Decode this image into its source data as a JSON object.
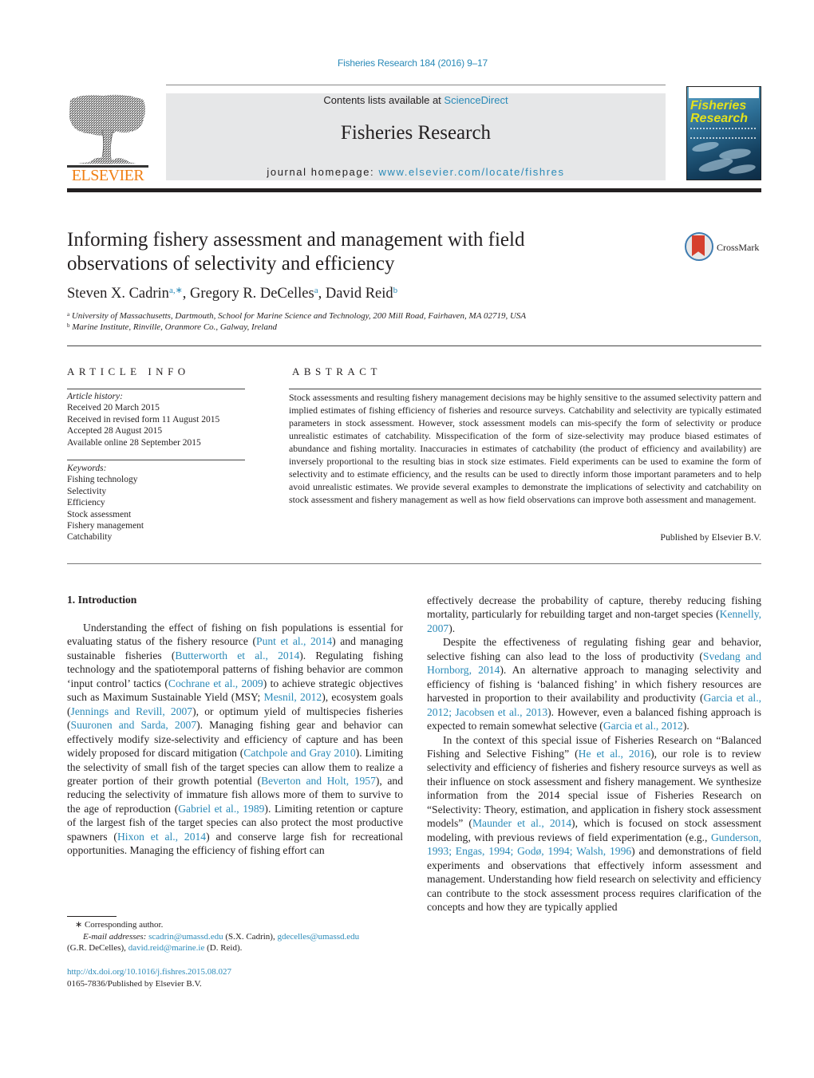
{
  "header": {
    "citation": "Fisheries Research 184 (2016) 9–17",
    "contents_prefix": "Contents lists available at ",
    "contents_link": "ScienceDirect",
    "journal_title": "Fisheries Research",
    "homepage_prefix": "journal homepage: ",
    "homepage_link": "www.elsevier.com/locate/fishres",
    "publisher_logo": "ELSEVIER",
    "cover_title_line1": "Fisheries",
    "cover_title_line2": "Research",
    "crossmark_label": "CrossMark"
  },
  "article": {
    "title": "Informing fishery assessment and management with field observations of selectivity and efficiency",
    "authors": [
      {
        "name": "Steven X. Cadrin",
        "marks": "a,∗"
      },
      {
        "name": "Gregory R. DeCelles",
        "marks": "a"
      },
      {
        "name": "David Reid",
        "marks": "b"
      }
    ],
    "affiliations": [
      {
        "mark": "a",
        "text": "University of Massachusetts, Dartmouth, School for Marine Science and Technology, 200 Mill Road, Fairhaven, MA 02719, USA"
      },
      {
        "mark": "b",
        "text": "Marine Institute, Rinville, Oranmore Co., Galway, Ireland"
      }
    ]
  },
  "article_info": {
    "heading": "ARTICLE INFO",
    "history_label": "Article history:",
    "history": [
      "Received 20 March 2015",
      "Received in revised form 11 August 2015",
      "Accepted 28 August 2015",
      "Available online 28 September 2015"
    ],
    "keywords_label": "Keywords:",
    "keywords": [
      "Fishing technology",
      "Selectivity",
      "Efficiency",
      "Stock assessment",
      "Fishery management",
      "Catchability"
    ]
  },
  "abstract": {
    "heading": "ABSTRACT",
    "text": "Stock assessments and resulting fishery management decisions may be highly sensitive to the assumed selectivity pattern and implied estimates of fishing efficiency of fisheries and resource surveys. Catchability and selectivity are typically estimated parameters in stock assessment. However, stock assessment models can mis-specify the form of selectivity or produce unrealistic estimates of catchability. Misspecification of the form of size-selectivity may produce biased estimates of abundance and fishing mortality. Inaccuracies in estimates of catchability (the product of efficiency and availability) are inversely proportional to the resulting bias in stock size estimates. Field experiments can be used to examine the form of selectivity and to estimate efficiency, and the results can be used to directly inform those important parameters and to help avoid unrealistic estimates. We provide several examples to demonstrate the implications of selectivity and catchability on stock assessment and fishery management as well as how field observations can improve both assessment and management.",
    "publisher": "Published by Elsevier B.V."
  },
  "introduction": {
    "heading": "1.  Introduction",
    "left_paragraph": [
      {
        "t": "Understanding the effect of fishing on fish populations is essential for evaluating status of the fishery resource ("
      },
      {
        "l": "Punt et al., 2014"
      },
      {
        "t": ") and managing sustainable fisheries ("
      },
      {
        "l": "Butterworth et al., 2014"
      },
      {
        "t": "). Regulating fishing technology and the spatiotemporal patterns of fishing behavior are common ‘input control’ tactics ("
      },
      {
        "l": "Cochrane et al., 2009"
      },
      {
        "t": ") to achieve strategic objectives such as Maximum Sustainable Yield (MSY; "
      },
      {
        "l": "Mesnil, 2012"
      },
      {
        "t": "), ecosystem goals ("
      },
      {
        "l": "Jennings and Revill, 2007"
      },
      {
        "t": "), or optimum yield of multispecies fisheries ("
      },
      {
        "l": "Suuronen and Sarda, 2007"
      },
      {
        "t": "). Managing fishing gear and behavior can effectively modify size-selectivity and efficiency of capture and has been widely proposed for discard mitigation ("
      },
      {
        "l": "Catchpole and Gray 2010"
      },
      {
        "t": "). Limiting the selectivity of small fish of the target species can allow them to realize a greater portion of their growth potential ("
      },
      {
        "l": "Beverton and Holt, 1957"
      },
      {
        "t": "), and reducing the selectivity of immature fish allows more of them to survive to the age of reproduction ("
      },
      {
        "l": "Gabriel et al., 1989"
      },
      {
        "t": "). Limiting retention or capture of the largest fish of the target species can also protect the most productive spawners ("
      },
      {
        "l": "Hixon et al., 2014"
      },
      {
        "t": ") and conserve large fish for recreational opportunities. Managing the efficiency of fishing effort can"
      }
    ],
    "right_paragraphs": [
      {
        "indent": false,
        "parts": [
          {
            "t": "effectively decrease the probability of capture, thereby reducing fishing mortality, particularly for rebuilding target and non-target species ("
          },
          {
            "l": "Kennelly, 2007"
          },
          {
            "t": ")."
          }
        ]
      },
      {
        "indent": true,
        "parts": [
          {
            "t": "Despite the effectiveness of regulating fishing gear and behavior, selective fishing can also lead to the loss of productivity ("
          },
          {
            "l": "Svedang and Hornborg, 2014"
          },
          {
            "t": "). An alternative approach to managing selectivity and efficiency of fishing is ‘balanced fishing’ in which fishery resources are harvested in proportion to their availability and productivity ("
          },
          {
            "l": "Garcia et al., 2012; Jacobsen et al., 2013"
          },
          {
            "t": "). However, even a balanced fishing approach is expected to remain somewhat selective ("
          },
          {
            "l": "Garcia et al., 2012"
          },
          {
            "t": ")."
          }
        ]
      },
      {
        "indent": true,
        "parts": [
          {
            "t": "In the context of this special issue of Fisheries Research on “Balanced Fishing and Selective Fishing” ("
          },
          {
            "l": "He et al., 2016"
          },
          {
            "t": "), our role is to review selectivity and efficiency of fisheries and fishery resource surveys as well as their influence on stock assessment and fishery management. We synthesize information from the 2014 special issue of Fisheries Research on “Selectivity: Theory, estimation, and application in fishery stock assessment models” ("
          },
          {
            "l": "Maunder et al., 2014"
          },
          {
            "t": "), which is focused on stock assessment modeling, with previous reviews of field experimentation (e.g., "
          },
          {
            "l": "Gunderson, 1993; Engas, 1994; Godø, 1994; Walsh, 1996"
          },
          {
            "t": ") and demonstrations of field experiments and observations that effectively inform assessment and management. Understanding how field research on selectivity and efficiency can contribute to the stock assessment process requires clarification of the concepts and how they are typically applied"
          }
        ]
      }
    ]
  },
  "footnotes": {
    "corresponding": "∗  Corresponding author.",
    "email_label": "E-mail addresses:",
    "emails": [
      {
        "addr": "scadrin@umassd.edu",
        "who": " (S.X. Cadrin), "
      },
      {
        "addr": "gdecelles@umassd.edu",
        "who": " (G.R. DeCelles), "
      },
      {
        "addr": "david.reid@marine.ie",
        "who": " (D. Reid)."
      }
    ],
    "doi": "http://dx.doi.org/10.1016/j.fishres.2015.08.027",
    "issn": "0165-7836/Published by Elsevier B.V."
  },
  "colors": {
    "link": "#2a8ab8",
    "elsevier_orange": "#f07f13",
    "banner_gray": "#e6e7e8",
    "text": "#231f20"
  }
}
